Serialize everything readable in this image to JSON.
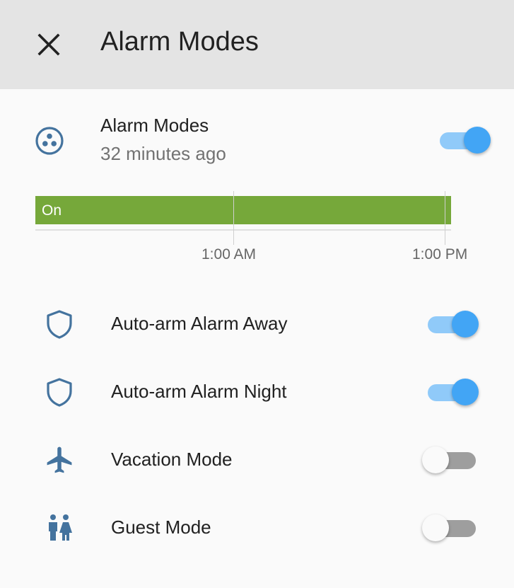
{
  "header": {
    "title": "Alarm Modes",
    "close_icon": "close-icon"
  },
  "summary": {
    "icon": "alarm-modes-icon",
    "name": "Alarm Modes",
    "last_changed": "32 minutes ago",
    "state": "on"
  },
  "timeline": {
    "bar_label": "On",
    "bar_color": "#76a83a",
    "ticks": [
      "1:00 AM",
      "1:00 PM"
    ]
  },
  "colors": {
    "accent": "#42a5f5",
    "accent_track": "#90caf9",
    "icon": "#44739e",
    "header_bg": "#e4e4e4"
  },
  "items": [
    {
      "label": "Auto-arm Alarm Away",
      "icon": "shield-icon",
      "state": "on"
    },
    {
      "label": "Auto-arm Alarm Night",
      "icon": "shield-icon",
      "state": "on"
    },
    {
      "label": "Vacation Mode",
      "icon": "airplane-icon",
      "state": "off"
    },
    {
      "label": "Guest Mode",
      "icon": "guests-icon",
      "state": "off"
    }
  ]
}
